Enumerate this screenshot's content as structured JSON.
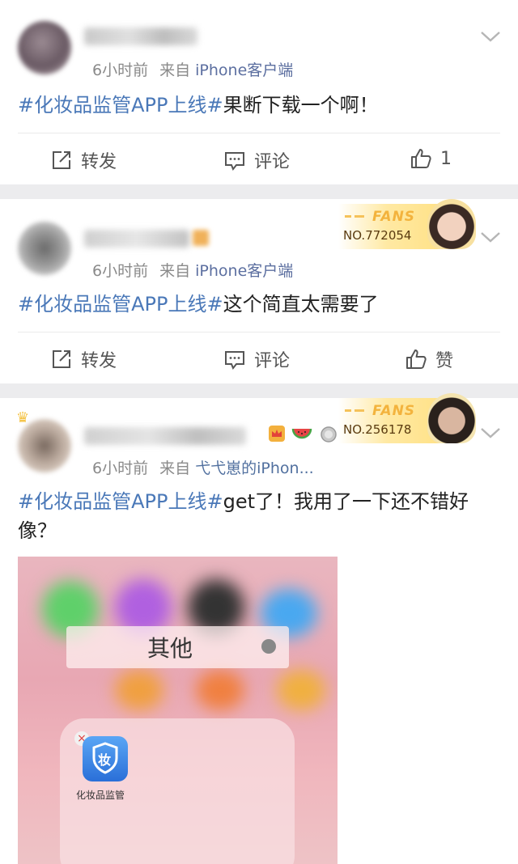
{
  "posts": [
    {
      "time": "6小时前",
      "source_prefix": "来自",
      "source_name": "iPhone客户端",
      "topic": "#化妆品监管APP上线#",
      "body": "果断下载一个啊！",
      "actions": {
        "repost": "转发",
        "comment": "评论",
        "like": "1"
      }
    },
    {
      "time": "6小时前",
      "source_prefix": "来自",
      "source_name": "iPhone客户端",
      "topic": "#化妆品监管APP上线#",
      "body": "这个简直太需要了",
      "fans_badge": {
        "title": "FANS",
        "number": "NO.772054"
      },
      "actions": {
        "repost": "转发",
        "comment": "评论",
        "like": "赞"
      }
    },
    {
      "time": "6小时前",
      "source_prefix": "来自",
      "source_name": "弋弋崽的iPhon...",
      "topic": "#化妆品监管APP上线#",
      "body": "get了！我用了一下还不错好像？",
      "fans_badge": {
        "title": "FANS",
        "number": "NO.256178"
      },
      "screenshot": {
        "folder_name": "其他",
        "app_label": "化妆品监管",
        "app_glyph": "妆"
      }
    }
  ],
  "colors": {
    "topic": "#4a78b8",
    "meta": "#8a8a8a",
    "link": "#51709f",
    "fans": "#f3b33d"
  },
  "icons": [
    "chevron-down-icon",
    "repost-icon",
    "comment-icon",
    "like-icon"
  ]
}
